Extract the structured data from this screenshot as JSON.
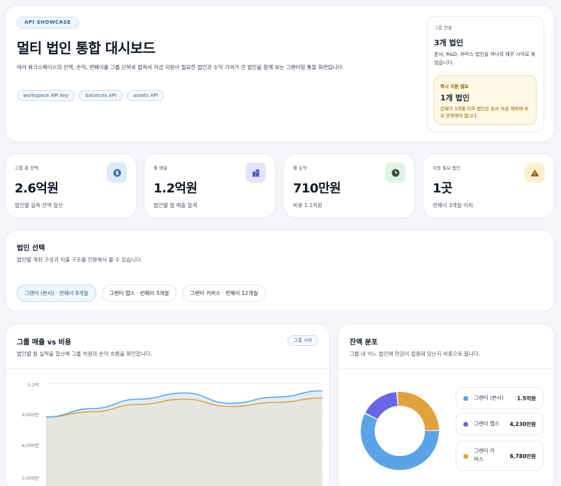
{
  "hero": {
    "badge": "API SHOWCASE",
    "title": "멀티 법인 통합 대시보드",
    "description": "여러 워크스페이스의 잔액, 손익, 런웨이를 그룹 단위로 합쳐서 자금 지원이 필요한 법인과 수익 기여가 큰 법인을 함께 보는 그랜터형 통합 화면입니다.",
    "chips": [
      "workspace API key",
      "balances API",
      "assets API"
    ],
    "status": {
      "label": "그룹 현황",
      "value": "3개 법인",
      "description": "본사, R&D, 커머스 법인을 하나의 재무 시야로 묶었습니다.",
      "alert_label": "즉시 지원 필요",
      "alert_value": "1개 법인",
      "alert_description": "런웨이 3개월 이하 법인은 본사 자금 계획에 바로 반영해야 합니다."
    }
  },
  "stats": [
    {
      "label": "그룹 총 잔액",
      "value": "2.6억원",
      "sub": "법인별 실측 잔액 합산",
      "icon": "dollar-coin-icon",
      "icon_bg": "#dceaf9",
      "icon_fg": "#3f6fa6"
    },
    {
      "label": "월 매출",
      "value": "1.2억원",
      "sub": "법인별 월 매출 합계",
      "icon": "buildings-icon",
      "icon_bg": "#e1e5fb",
      "icon_fg": "#4f59c9"
    },
    {
      "label": "월 손익",
      "value": "710만원",
      "sub": "비용 1.1억원",
      "icon": "clock-icon",
      "icon_bg": "#dff3e6",
      "icon_fg": "#3a4a3f"
    },
    {
      "label": "지원 필요 법인",
      "value": "1곳",
      "sub": "런웨이 3개월 이하",
      "icon": "warning-icon",
      "icon_bg": "#fbf0cf",
      "icon_fg": "#9a5a2a"
    }
  ],
  "selection": {
    "title": "법인 선택",
    "description": "법인별 계좌 구성과 지출 구조를 전환해서 볼 수 있습니다.",
    "entities": [
      "그랜터 (본사) · 런웨이 8개월",
      "그랜터 랩스 · 런웨이 3개월",
      "그랜터 커머스 · 런웨이 12개월"
    ],
    "active_index": 0
  },
  "chart_section": {
    "title": "그룹 매출 vs 비용",
    "description": "법인별 월 실적을 합산해 그룹 차원의 손익 흐름을 확인합니다.",
    "scope_label": "그룹 시야",
    "colors": {
      "revenue": "#5ba3e6",
      "cost": "#e1a23a",
      "area": "#e6e6e1"
    }
  },
  "chart_data": {
    "type": "area",
    "y_ticks": [
      "1.2억",
      "9,000만",
      "6,000만",
      "3,000만"
    ],
    "ylim": [
      0,
      120000000
    ],
    "x": [
      0,
      1,
      2,
      3,
      4,
      5,
      6
    ],
    "series": [
      {
        "values": [
          88000000,
          96000000,
          105000000,
          111000000,
          101000000,
          107000000,
          113000000
        ]
      },
      {
        "values": [
          88000000,
          93000000,
          100000000,
          105000000,
          98000000,
          102000000,
          106000000
        ]
      }
    ]
  },
  "distribution": {
    "title": "잔액 분포",
    "description": "그룹 내 어느 법인에 현금이 집중돼 있는지 비중으로 봅니다.",
    "items": [
      {
        "name": "그랜터 (본사)",
        "value": "1.5억원",
        "amount": 150000000,
        "color": "#5ba3e6"
      },
      {
        "name": "그랜터 랩스",
        "value": "4,230만원",
        "amount": 42300000,
        "color": "#6767e6"
      },
      {
        "name": "그랜터 커머스",
        "value": "6,780만원",
        "amount": 67800000,
        "color": "#e1a23a"
      }
    ]
  }
}
